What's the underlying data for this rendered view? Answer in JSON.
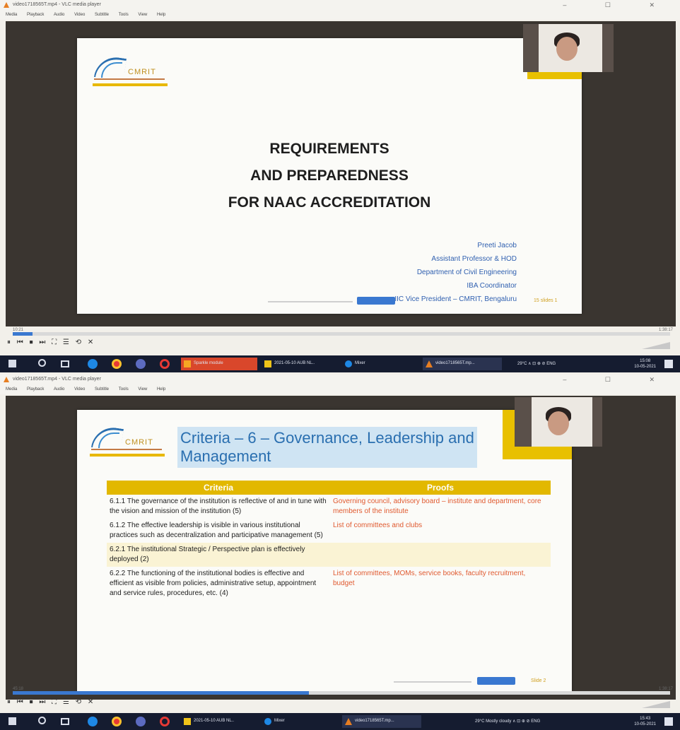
{
  "player": {
    "window_title": "video1718565T.mp4 - VLC media player",
    "menu_items": [
      "Media",
      "Playback",
      "Audio",
      "Video",
      "Subtitle",
      "Tools",
      "View",
      "Help"
    ],
    "window_controls": "–   ☐   ✕"
  },
  "slide1": {
    "logo_text": "CMRIT",
    "title_lines": [
      "REQUIREMENTS",
      "AND PREPAREDNESS",
      "FOR NAAC ACCREDITATION"
    ],
    "presenter_lines": [
      "Preeti Jacob",
      "Assistant Professor & HOD",
      "Department of Civil Engineering",
      "IBA Coordinator",
      "IIC Vice President – CMRIT, Bengaluru"
    ],
    "page_label": "15 slides 1"
  },
  "slide2": {
    "logo_text": "CMRIT",
    "title": "Criteria – 6 – Governance, Leadership and Management",
    "table_headers": [
      "Criteria",
      "Proofs"
    ],
    "rows": [
      {
        "criteria": "6.1.1 The governance of the institution is reflective of and in tune with the vision and mission of the institution (5)",
        "proofs": "Governing council, advisory board – institute and department, core members of the institute"
      },
      {
        "criteria": "6.1.2 The effective leadership is visible in various institutional practices such as decentralization and participative management (5)",
        "proofs": "List of committees and clubs"
      },
      {
        "criteria": "6.2.1 The institutional Strategic / Perspective plan is effectively deployed (2)",
        "proofs": ""
      },
      {
        "criteria": "6.2.2 The functioning of the institutional bodies is effective and efficient as visible from policies, administrative setup, appointment and service rules, procedures, etc. (4)",
        "proofs": "List of committees, MOMs, service books, faculty recruitment, budget"
      }
    ],
    "page_label": "Slide 2"
  },
  "playback1": {
    "time_elapsed": "10:21",
    "time_total": "1:38:17",
    "progress": 0.03
  },
  "playback2": {
    "time_elapsed": "45:18",
    "time_total": "1:38:17",
    "progress": 0.45
  },
  "controls": [
    "⏸",
    "⏮",
    "⏹",
    "⏭",
    "⛶",
    "☰",
    "⟲",
    "✕"
  ],
  "taskbar": {
    "buttons1": [
      "Sparkle module",
      "2021-05-10 AUB NL..",
      "Mixer",
      "video1718565T.mp..."
    ],
    "buttons2": [
      "2021-05-10 AUB NL..",
      "Mixer",
      "video1718565T.mp..."
    ],
    "tray1": "29°C  ∧  ⊡  ⊕  ⊘  ENG",
    "tray2": "29°C  Mostly cloudy  ∧  ⊡  ⊕  ⊘  ENG",
    "clock_time1": "15:08",
    "clock_time2": "15:43",
    "clock_date": "10-05-2021"
  },
  "colors": {
    "slide_accent_yellow": "#e2b800",
    "title_blue": "#2a6fb0",
    "proof_orange": "#e05a30",
    "taskbar": "#151c30"
  }
}
